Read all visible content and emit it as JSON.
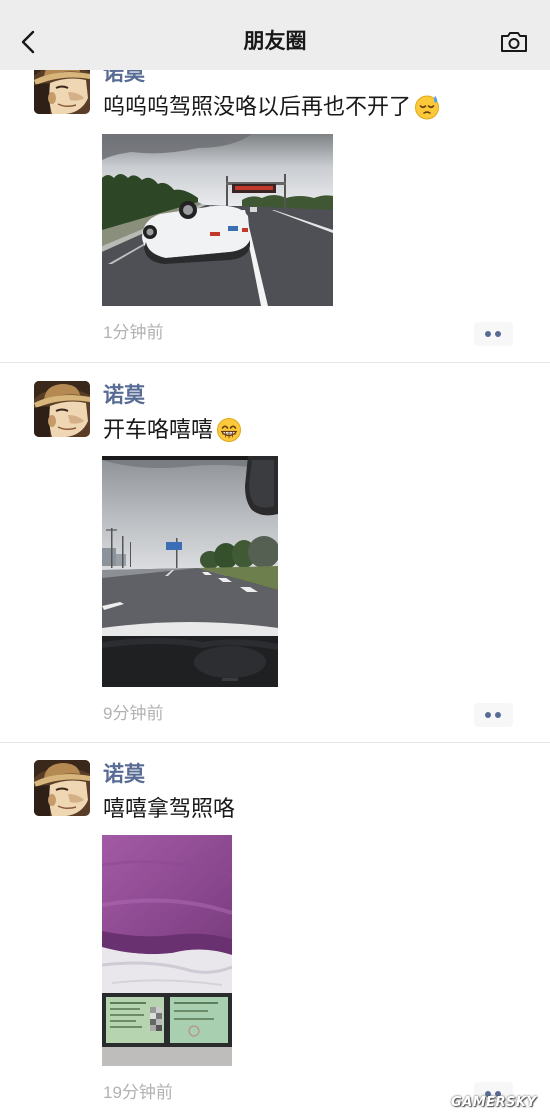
{
  "header": {
    "title": "朋友圈",
    "back_icon": "chevron-left-icon",
    "camera_icon": "camera-icon"
  },
  "colors": {
    "page_bg": "#ffffff",
    "header_bg": "#ededed",
    "name": "#576b95",
    "text": "#191919",
    "time": "#b2b2b2",
    "divider": "#e6e6e6",
    "more_bg": "#f7f7f7"
  },
  "posts": [
    {
      "author": "诺莫",
      "text": "呜呜呜驾照没咯以后再也不开了",
      "emoji": "downcast-face-with-sweat-emoji",
      "time": "1分钟前",
      "more_icon": "more-dots-icon"
    },
    {
      "author": "诺莫",
      "text": "开车咯嘻嘻",
      "emoji": "grinning-face-emoji",
      "time": "9分钟前",
      "more_icon": "more-dots-icon"
    },
    {
      "author": "诺莫",
      "text": "嘻嘻拿驾照咯",
      "time": "19分钟前",
      "more_icon": "more-dots-icon"
    }
  ],
  "watermark": "GAMERSKY"
}
